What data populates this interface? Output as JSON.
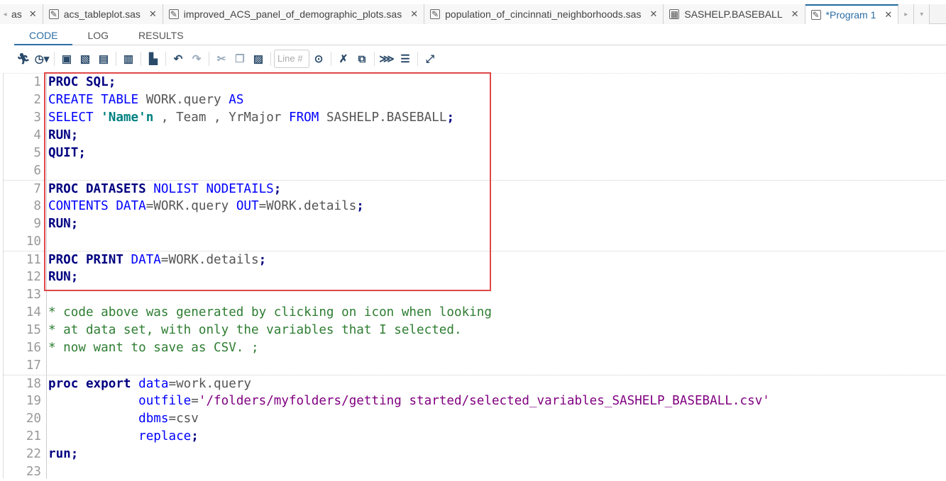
{
  "tabs": [
    {
      "label": "as",
      "icon": "scroll-left-icon",
      "partial": true
    },
    {
      "label": "acs_tableplot.sas"
    },
    {
      "label": "improved_ACS_panel_of_demographic_plots.sas"
    },
    {
      "label": "population_of_cincinnati_neighborhoods.sas"
    },
    {
      "label": "SASHELP.BASEBALL",
      "type": "table"
    },
    {
      "label": "*Program 1",
      "active": true
    }
  ],
  "close_glyph": "✕",
  "subtabs": [
    "CODE",
    "LOG",
    "RESULTS"
  ],
  "toolbar": {
    "line_placeholder": "Line #"
  },
  "code": [
    [
      [
        "PROC SQL;",
        "kw"
      ]
    ],
    [
      [
        "CREATE TABLE ",
        "kw2"
      ],
      [
        "WORK.query ",
        "txt"
      ],
      [
        "AS",
        "kw2"
      ]
    ],
    [
      [
        "SELECT ",
        "kw2"
      ],
      [
        "'Name'n",
        "str"
      ],
      [
        " , Team , YrMajor ",
        "txt"
      ],
      [
        "FROM ",
        "kw2"
      ],
      [
        "SASHELP.BASEBALL",
        "txt"
      ],
      [
        ";",
        "kw"
      ]
    ],
    [
      [
        "RUN;",
        "kw"
      ]
    ],
    [
      [
        "QUIT;",
        "kw"
      ]
    ],
    [],
    [
      [
        "PROC DATASETS ",
        "kw"
      ],
      [
        "NOLIST NODETAILS",
        "kw2"
      ],
      [
        ";",
        "kw"
      ]
    ],
    [
      [
        "CONTENTS DATA",
        "kw2"
      ],
      [
        "=WORK.query ",
        "txt"
      ],
      [
        "OUT",
        "kw2"
      ],
      [
        "=WORK.details",
        "txt"
      ],
      [
        ";",
        "kw"
      ]
    ],
    [
      [
        "RUN;",
        "kw"
      ]
    ],
    [],
    [
      [
        "PROC PRINT ",
        "kw"
      ],
      [
        "DATA",
        "kw2"
      ],
      [
        "=WORK.details",
        "txt"
      ],
      [
        ";",
        "kw"
      ]
    ],
    [
      [
        "RUN;",
        "kw"
      ]
    ],
    [],
    [
      [
        "* code above was generated by clicking on icon when looking",
        "cmt"
      ]
    ],
    [
      [
        "* at data set, with only the variables that I selected.",
        "cmt"
      ]
    ],
    [
      [
        "* now want to save as CSV. ;",
        "cmt"
      ]
    ],
    [],
    [
      [
        "proc export ",
        "kw"
      ],
      [
        "data",
        "kw2"
      ],
      [
        "=work.query",
        "txt"
      ]
    ],
    [
      [
        "            outfile",
        "kw2"
      ],
      [
        "=",
        "txt"
      ],
      [
        "'/folders/myfolders/getting started/selected_variables_SASHELP_BASEBALL.csv'",
        "path"
      ]
    ],
    [
      [
        "            dbms",
        "kw2"
      ],
      [
        "=csv",
        "txt"
      ]
    ],
    [
      [
        "            replace",
        "kw2"
      ],
      [
        ";",
        "kw"
      ]
    ],
    [
      [
        "run;",
        "kw"
      ]
    ],
    []
  ]
}
